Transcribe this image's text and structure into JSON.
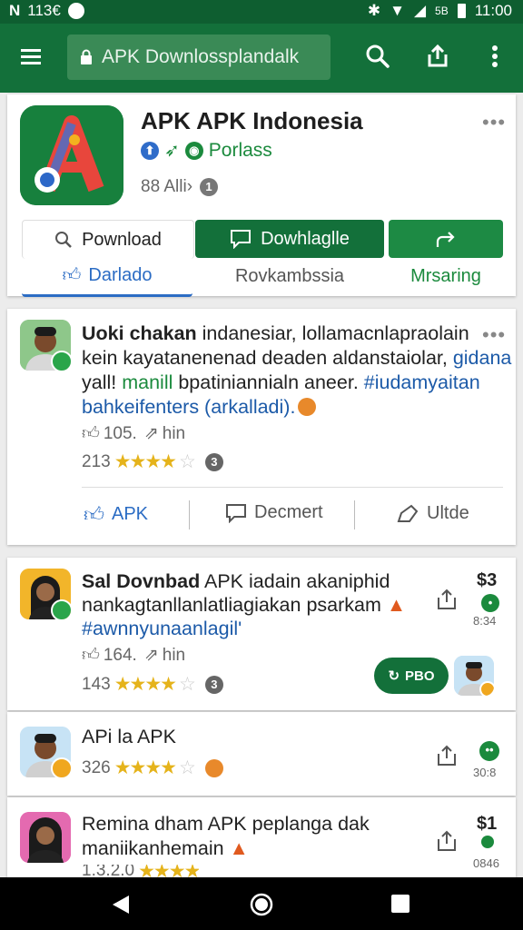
{
  "status": {
    "left_icon": "N",
    "time_left": "113€",
    "time_right": "11:00",
    "signal_label": "5B"
  },
  "header": {
    "url": "APK Downlossplandalk"
  },
  "app": {
    "title": "APK APK Indonesia",
    "badge_label": "Porlass",
    "meta_text": "88 Alli›",
    "meta_badge": "1",
    "tabs": {
      "search_label": "Pownload",
      "primary_label": "Dowhlaglle",
      "like_label": "Darlado",
      "secondary_label": "Rovkambssia",
      "share_label": "Mrsaring"
    }
  },
  "post1": {
    "line1_bold": "Uoki chakan",
    "line1_rest": " indanesiar, lollamacnlapraolain",
    "line2_a": "kein kayatanenenad deaden aldanstaiolar, ",
    "line2_b": "gidana",
    "line3_a": "yall! ",
    "line3_b": "manill",
    "line3_c": " bpatiniannialn aneer. ",
    "line3_d": "#iudamyaitan",
    "line4": "bahkeifenters (arkalladi).",
    "likes": "105.",
    "share_text": "hin",
    "rating_count": "213",
    "badge": "3",
    "actions": {
      "like": "APK",
      "comment": "Decmert",
      "share": "Ultde"
    }
  },
  "post2": {
    "line1_bold": "Sal Dovnbad",
    "line1_rest": " APK iadain akaniphid",
    "line2": "nankagtanllanlatliagiakan psarkam",
    "line3": "#awnnyunaanlagil'",
    "likes": "164.",
    "share_text": "hin",
    "rating_count": "143",
    "badge": "3",
    "price": "$3",
    "count": "8:34",
    "pill": "PBO"
  },
  "post3": {
    "title": "APi la APK",
    "rating_count": "326",
    "count": "30:8"
  },
  "post4": {
    "line1": "Remina dham APK peplanga dak",
    "line2": "maniikanhemain",
    "rating_count": "1.3.2.0",
    "price": "$1",
    "count": "0846"
  },
  "colors": {
    "primary": "#13703a",
    "status_bar": "#0e5e30",
    "link": "#1c5aa8",
    "star": "#e5b31b",
    "badge_green": "#1b8a3d"
  }
}
